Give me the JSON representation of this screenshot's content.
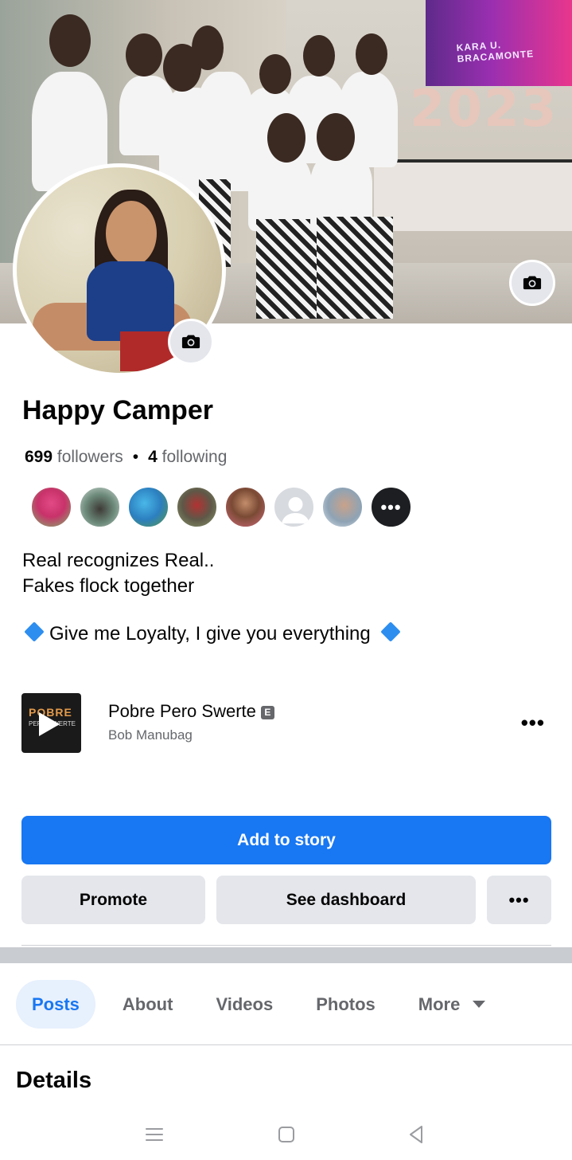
{
  "profile": {
    "name": "Happy Camper",
    "followers_count": "699",
    "followers_label": "followers",
    "following_count": "4",
    "following_label": "following",
    "friends_more": "•••"
  },
  "cover": {
    "tv_text_line1": "KARA U. BRACAMONTE",
    "balloons_text": "2023"
  },
  "bio": {
    "line1": "Real recognizes Real..",
    "line2": "Fakes flock together",
    "line3": "Give me Loyalty, I give you everything"
  },
  "music": {
    "album_title": "POBRE",
    "album_subtitle": "PERO SWERTE",
    "song_title": "Pobre Pero Swerte",
    "explicit_badge": "E",
    "artist": "Bob Manubag",
    "more": "•••"
  },
  "actions": {
    "add_to_story": "Add to story",
    "promote": "Promote",
    "see_dashboard": "See dashboard",
    "more": "•••"
  },
  "tabs": [
    {
      "label": "Posts",
      "active": true
    },
    {
      "label": "About",
      "active": false
    },
    {
      "label": "Videos",
      "active": false
    },
    {
      "label": "Photos",
      "active": false
    },
    {
      "label": "More",
      "active": false
    }
  ],
  "section_title": "Details",
  "colors": {
    "accent": "#1877f2",
    "button_gray": "#e4e6eb",
    "secondary_text": "#65676b",
    "diamond_blue": "#2d8ef0"
  },
  "icons": {
    "cover_camera": "camera-icon",
    "avatar_camera": "camera-icon",
    "bio_diamond": "blue-diamond-icon",
    "music_play": "play-icon",
    "tab_more": "caret-down-icon",
    "nav_menu": "menu-icon",
    "nav_home": "home-square-icon",
    "nav_back": "back-triangle-icon"
  }
}
